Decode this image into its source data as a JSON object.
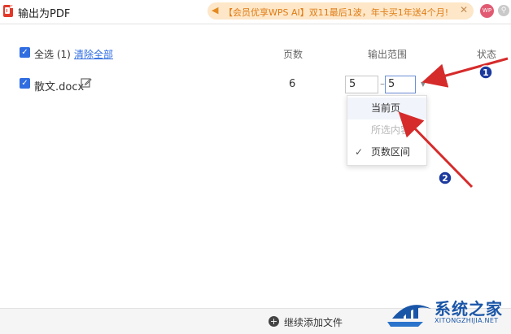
{
  "window": {
    "title": "输出为PDF"
  },
  "promo": {
    "text": "【会员优享WPS AI】双11最后1波，年卡买1年送4个月!",
    "close_glyph": "✕"
  },
  "avatar": {
    "label": "WP"
  },
  "header": {
    "select_all": "全选 (1)",
    "clear_all": "清除全部",
    "col_pages": "页数",
    "col_range": "输出范围",
    "col_status": "状态"
  },
  "file": {
    "name": "散文.docx",
    "pages": "6",
    "range_from": "5",
    "range_to": "5",
    "range_dash": "–"
  },
  "dropdown": {
    "items": [
      {
        "label": "当前页",
        "state": "hover"
      },
      {
        "label": "所选内容",
        "state": "disabled"
      },
      {
        "label": "页数区间",
        "state": "selected"
      }
    ]
  },
  "footer": {
    "add_label": "继续添加文件"
  },
  "annotations": {
    "badge_1": "1",
    "badge_2": "2"
  },
  "watermark": {
    "title": "系统之家",
    "url": "XITONGZHIJIA.NET"
  },
  "colors": {
    "accent": "#2f6de1",
    "arrow": "#d62b2b",
    "promo_bg": "#fde7c8"
  },
  "icons": [
    "pdf-app-icon",
    "speaker-icon",
    "close-icon",
    "bell-icon",
    "checkbox-icon",
    "edit-icon",
    "chevron-down-icon",
    "check-icon",
    "add-circle-icon"
  ]
}
